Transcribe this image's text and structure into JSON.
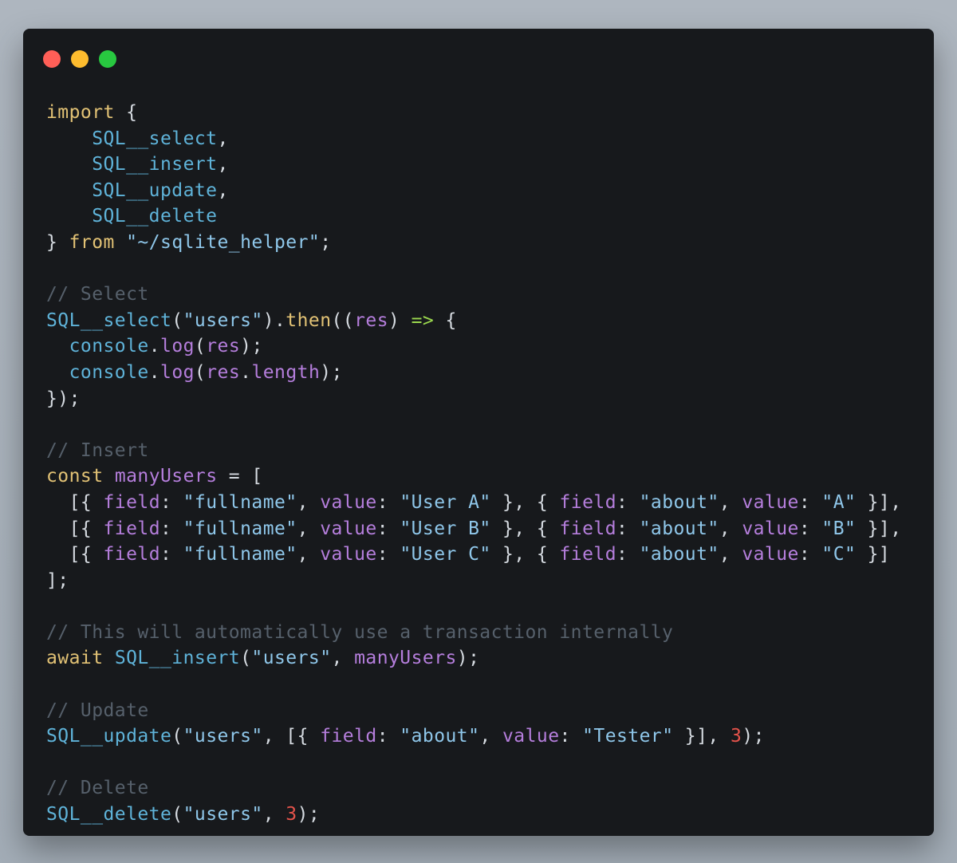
{
  "window": {
    "controls": [
      {
        "name": "close",
        "color": "#ff5f57"
      },
      {
        "name": "minimize",
        "color": "#febc2e"
      },
      {
        "name": "maximize",
        "color": "#28c840"
      }
    ]
  },
  "colors": {
    "background": "#a7b0ba",
    "editor_bg": "#17191c"
  },
  "code": {
    "lines": [
      [
        [
          "keyword",
          "import"
        ],
        [
          "punct",
          " {"
        ]
      ],
      [
        [
          "ident",
          "    SQL__select"
        ],
        [
          "punct",
          ","
        ]
      ],
      [
        [
          "ident",
          "    SQL__insert"
        ],
        [
          "punct",
          ","
        ]
      ],
      [
        [
          "ident",
          "    SQL__update"
        ],
        [
          "punct",
          ","
        ]
      ],
      [
        [
          "ident",
          "    SQL__delete"
        ]
      ],
      [
        [
          "punct",
          "} "
        ],
        [
          "keyword",
          "from"
        ],
        [
          "punct",
          " "
        ],
        [
          "string",
          "\"~/sqlite_helper\""
        ],
        [
          "punct",
          ";"
        ]
      ],
      [],
      [
        [
          "comment",
          "// Select"
        ]
      ],
      [
        [
          "fn",
          "SQL__select"
        ],
        [
          "punct",
          "("
        ],
        [
          "string",
          "\"users\""
        ],
        [
          "punct",
          ")."
        ],
        [
          "objname",
          "then"
        ],
        [
          "punct",
          "(("
        ],
        [
          "var",
          "res"
        ],
        [
          "punct",
          ") "
        ],
        [
          "arrow",
          "=>"
        ],
        [
          "punct",
          " {"
        ]
      ],
      [
        [
          "punct",
          "  "
        ],
        [
          "ident",
          "console"
        ],
        [
          "punct",
          "."
        ],
        [
          "method",
          "log"
        ],
        [
          "punct",
          "("
        ],
        [
          "var",
          "res"
        ],
        [
          "punct",
          ");"
        ]
      ],
      [
        [
          "punct",
          "  "
        ],
        [
          "ident",
          "console"
        ],
        [
          "punct",
          "."
        ],
        [
          "method",
          "log"
        ],
        [
          "punct",
          "("
        ],
        [
          "var",
          "res"
        ],
        [
          "punct",
          "."
        ],
        [
          "method",
          "length"
        ],
        [
          "punct",
          ");"
        ]
      ],
      [
        [
          "punct",
          "});"
        ]
      ],
      [],
      [
        [
          "comment",
          "// Insert"
        ]
      ],
      [
        [
          "keyword",
          "const"
        ],
        [
          "punct",
          " "
        ],
        [
          "var",
          "manyUsers"
        ],
        [
          "punct",
          " = ["
        ]
      ],
      [
        [
          "punct",
          "  [{ "
        ],
        [
          "objkey",
          "field"
        ],
        [
          "punct",
          ": "
        ],
        [
          "string",
          "\"fullname\""
        ],
        [
          "punct",
          ", "
        ],
        [
          "objkey",
          "value"
        ],
        [
          "punct",
          ": "
        ],
        [
          "string",
          "\"User A\""
        ],
        [
          "punct",
          " }, { "
        ],
        [
          "objkey",
          "field"
        ],
        [
          "punct",
          ": "
        ],
        [
          "string",
          "\"about\""
        ],
        [
          "punct",
          ", "
        ],
        [
          "objkey",
          "value"
        ],
        [
          "punct",
          ": "
        ],
        [
          "string",
          "\"A\""
        ],
        [
          "punct",
          " }],"
        ]
      ],
      [
        [
          "punct",
          "  [{ "
        ],
        [
          "objkey",
          "field"
        ],
        [
          "punct",
          ": "
        ],
        [
          "string",
          "\"fullname\""
        ],
        [
          "punct",
          ", "
        ],
        [
          "objkey",
          "value"
        ],
        [
          "punct",
          ": "
        ],
        [
          "string",
          "\"User B\""
        ],
        [
          "punct",
          " }, { "
        ],
        [
          "objkey",
          "field"
        ],
        [
          "punct",
          ": "
        ],
        [
          "string",
          "\"about\""
        ],
        [
          "punct",
          ", "
        ],
        [
          "objkey",
          "value"
        ],
        [
          "punct",
          ": "
        ],
        [
          "string",
          "\"B\""
        ],
        [
          "punct",
          " }],"
        ]
      ],
      [
        [
          "punct",
          "  [{ "
        ],
        [
          "objkey",
          "field"
        ],
        [
          "punct",
          ": "
        ],
        [
          "string",
          "\"fullname\""
        ],
        [
          "punct",
          ", "
        ],
        [
          "objkey",
          "value"
        ],
        [
          "punct",
          ": "
        ],
        [
          "string",
          "\"User C\""
        ],
        [
          "punct",
          " }, { "
        ],
        [
          "objkey",
          "field"
        ],
        [
          "punct",
          ": "
        ],
        [
          "string",
          "\"about\""
        ],
        [
          "punct",
          ", "
        ],
        [
          "objkey",
          "value"
        ],
        [
          "punct",
          ": "
        ],
        [
          "string",
          "\"C\""
        ],
        [
          "punct",
          " }]"
        ]
      ],
      [
        [
          "punct",
          "];"
        ]
      ],
      [],
      [
        [
          "comment",
          "// This will automatically use a transaction internally"
        ]
      ],
      [
        [
          "keyword",
          "await"
        ],
        [
          "punct",
          " "
        ],
        [
          "fn",
          "SQL__insert"
        ],
        [
          "punct",
          "("
        ],
        [
          "string",
          "\"users\""
        ],
        [
          "punct",
          ", "
        ],
        [
          "var",
          "manyUsers"
        ],
        [
          "punct",
          ");"
        ]
      ],
      [],
      [
        [
          "comment",
          "// Update"
        ]
      ],
      [
        [
          "fn",
          "SQL__update"
        ],
        [
          "punct",
          "("
        ],
        [
          "string",
          "\"users\""
        ],
        [
          "punct",
          ", [{ "
        ],
        [
          "objkey",
          "field"
        ],
        [
          "punct",
          ": "
        ],
        [
          "string",
          "\"about\""
        ],
        [
          "punct",
          ", "
        ],
        [
          "objkey",
          "value"
        ],
        [
          "punct",
          ": "
        ],
        [
          "string",
          "\"Tester\""
        ],
        [
          "punct",
          " }], "
        ],
        [
          "number",
          "3"
        ],
        [
          "punct",
          ");"
        ]
      ],
      [],
      [
        [
          "comment",
          "// Delete"
        ]
      ],
      [
        [
          "fn",
          "SQL__delete"
        ],
        [
          "punct",
          "("
        ],
        [
          "string",
          "\"users\""
        ],
        [
          "punct",
          ", "
        ],
        [
          "number",
          "3"
        ],
        [
          "punct",
          ");"
        ]
      ]
    ]
  }
}
